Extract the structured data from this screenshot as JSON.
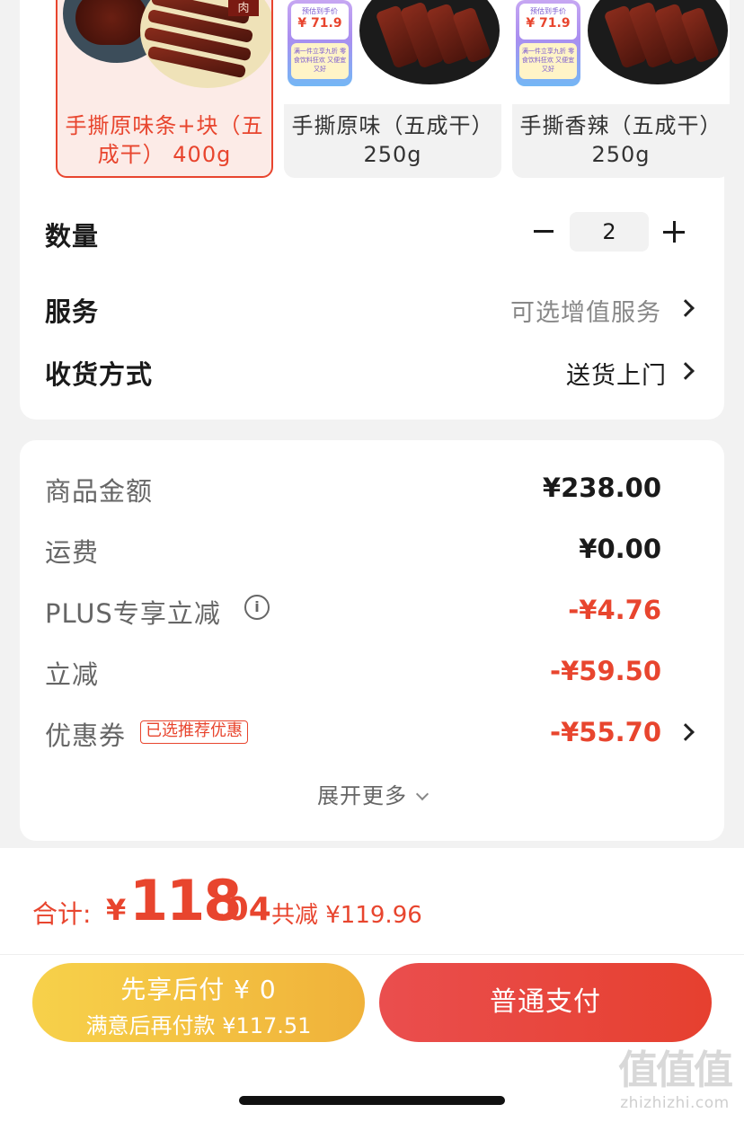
{
  "variants": [
    {
      "label": "手撕原味条+块（五成干） 400g",
      "selected": true
    },
    {
      "label": "手撕原味（五成干） 250g",
      "selected": false,
      "badge": {
        "title": "预估到手价",
        "price": "¥ 71.9",
        "promo": "满一件立享九折 零食饮料狂欢 又便宜又好"
      }
    },
    {
      "label": "手撕香辣（五成干） 250g",
      "selected": false,
      "badge": {
        "title": "预估到手价",
        "price": "¥ 71.9",
        "promo": "满一件立享九折 零食饮料狂欢 又便宜又好"
      }
    }
  ],
  "quantity": {
    "label": "数量",
    "value": "2"
  },
  "service": {
    "label": "服务",
    "value": "可选增值服务"
  },
  "delivery": {
    "label": "收货方式",
    "value": "送货上门"
  },
  "price_breakdown": {
    "goods": {
      "label": "商品金额",
      "value": "¥238.00"
    },
    "shipping": {
      "label": "运费",
      "value": "¥0.00"
    },
    "plus": {
      "label": "PLUS专享立减",
      "value": "-¥4.76"
    },
    "discount": {
      "label": "立减",
      "value": "-¥59.50"
    },
    "coupon": {
      "label": "优惠券",
      "tag": "已选推荐优惠",
      "value": "-¥55.70"
    },
    "expand": "展开更多"
  },
  "summary": {
    "total_label": "合计:",
    "currency": "¥",
    "total_int": "118",
    "total_dec": ".04",
    "saved": "共减 ¥119.96"
  },
  "buttons": {
    "later_line1": "先享后付 ¥ 0",
    "later_line2": "满意后再付款 ¥117.51",
    "pay": "普通支付"
  },
  "watermark": {
    "glyphs": "值值值",
    "site": "zhizhizhi.com"
  },
  "colors": {
    "accent": "#e8452e",
    "yellow": "#f7d14a",
    "red_button": "#e6402f"
  }
}
